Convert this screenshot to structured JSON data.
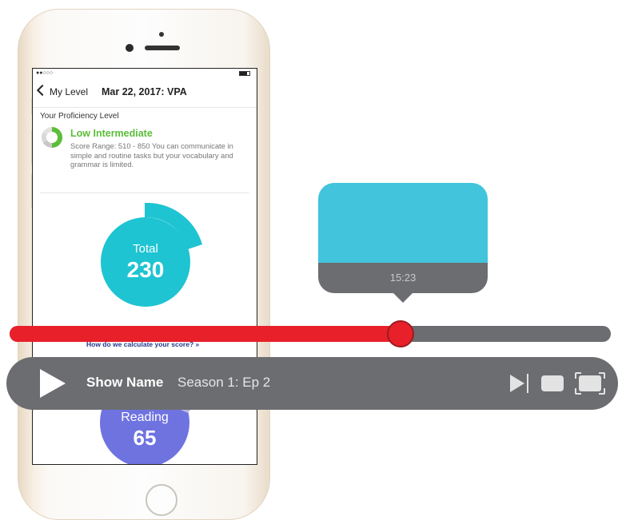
{
  "phone": {
    "status": {
      "signal": "●●○○○"
    },
    "nav": {
      "back_label": "My Level",
      "title": "Mar 22, 2017: VPA"
    },
    "proficiency": {
      "section_label": "Your Proficiency Level",
      "level_name": "Low Intermediate",
      "description": "Score Range: 510 - 850 You can communicate in simple and routine tasks but your vocabulary and grammar is limited."
    },
    "total": {
      "label": "Total",
      "value": "230"
    },
    "calc_link": "How do we calculate your score? »",
    "reading": {
      "label": "Reading",
      "value": "65"
    }
  },
  "player": {
    "tooltip_time": "15:23",
    "progress": 0.65,
    "show_name": "Show Name",
    "episode": "Season 1: Ep 2",
    "icons": [
      "play-icon",
      "skip-next-icon",
      "captions-icon",
      "fullscreen-icon"
    ]
  },
  "colors": {
    "level_green": "#5bbd38",
    "total_teal": "#1ec4d2",
    "reading_purple": "#6f73e0",
    "scrub_red": "#e8202a",
    "player_gray": "#6c6d70",
    "preview_blue": "#41c4dc"
  }
}
